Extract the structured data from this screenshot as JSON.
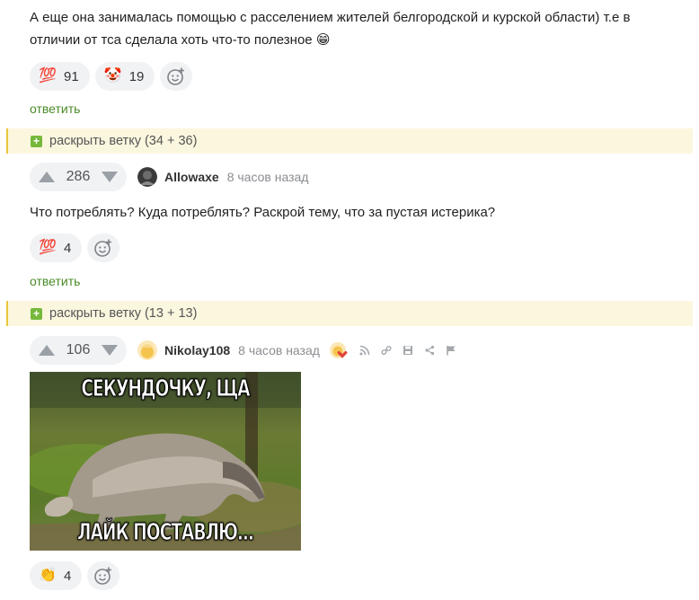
{
  "comment1": {
    "text": "А еще она занималась помощью с расселением жителей белгородской и курской области) т.е в отличии от тса сделала хоть что-то полезное 😁",
    "reactions": [
      {
        "emoji": "💯",
        "count": "91"
      },
      {
        "emoji": "🤡",
        "count": "19"
      }
    ],
    "reply_label": "ответить"
  },
  "branch1": {
    "label": "раскрыть ветку (34 + 36)"
  },
  "comment2": {
    "rating": "286",
    "username": "Allowaxe",
    "time": "8 часов назад",
    "text": "Что потреблять? Куда потреблять? Раскрой тему, что за пустая истерика?",
    "reactions": [
      {
        "emoji": "💯",
        "count": "4"
      }
    ],
    "reply_label": "ответить"
  },
  "branch2": {
    "label": "раскрыть ветку (13 + 13)"
  },
  "comment3": {
    "rating": "106",
    "username": "Nikolay108",
    "time": "8 часов назад",
    "image": {
      "top_caption": "СЕКУНДОЧКУ, ЩА",
      "bottom_caption": "ЛАЙК ПОСТАВЛЮ..."
    },
    "reactions": [
      {
        "emoji": "👏",
        "count": "4"
      }
    ]
  },
  "icons": {
    "add_reaction": "add-reaction-icon",
    "upvote": "arrow-up-icon",
    "downvote": "arrow-down-icon",
    "rss": "rss-icon",
    "link": "link-icon",
    "save": "save-icon",
    "share": "share-icon",
    "report": "flag-icon"
  },
  "colors": {
    "reply_link": "#4a8a28",
    "branch_bg": "#fbf6de",
    "branch_border": "#ebc63a",
    "plus_box": "#76b83b",
    "pill_bg": "#f1f2f4"
  }
}
